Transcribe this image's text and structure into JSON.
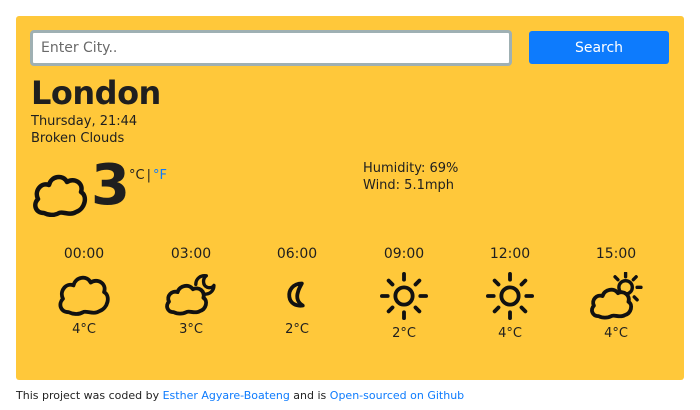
{
  "search": {
    "placeholder": "Enter City..",
    "value": "",
    "button_label": "Search"
  },
  "current": {
    "city": "London",
    "datetime": "Thursday, 21:44",
    "condition": "Broken Clouds",
    "icon": "cloud-icon",
    "temperature": "3",
    "unit_c": "°C",
    "unit_separator": "|",
    "unit_f": "°F",
    "humidity": "Humidity: 69%",
    "wind": "Wind: 5.1mph"
  },
  "forecast": [
    {
      "time": "00:00",
      "icon": "cloud-icon",
      "temp": "4°C"
    },
    {
      "time": "03:00",
      "icon": "cloud-moon-icon",
      "temp": "3°C"
    },
    {
      "time": "06:00",
      "icon": "moon-icon",
      "temp": "2°C"
    },
    {
      "time": "09:00",
      "icon": "sun-icon",
      "temp": "2°C"
    },
    {
      "time": "12:00",
      "icon": "sun-icon",
      "temp": "4°C"
    },
    {
      "time": "15:00",
      "icon": "cloud-sun-icon",
      "temp": "4°C"
    }
  ],
  "footer": {
    "text_before": "This project was coded by ",
    "author_link": "Esther Agyare-Boateng",
    "text_middle": " and is ",
    "repo_link": "Open-sourced on Github"
  },
  "colors": {
    "card": "#ffc83a",
    "accent": "#0d7bfd",
    "text": "#1f1f1f"
  }
}
